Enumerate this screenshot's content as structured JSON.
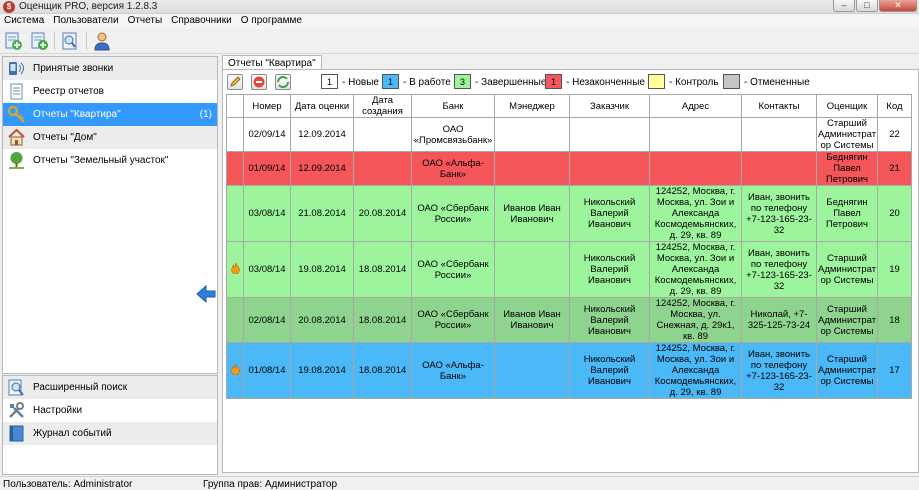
{
  "window": {
    "title": "Оценщик PRO, версия 1.2.8.3",
    "app_icon_letter": "$"
  },
  "menu": [
    "Система",
    "Пользователи",
    "Отчеты",
    "Справочники",
    "О программе"
  ],
  "toolbar_icons": [
    "new-report-icon",
    "add-report-icon",
    "preview-report-icon",
    "user-icon"
  ],
  "sidebar": {
    "items": [
      {
        "label": "Принятые звонки",
        "icon": "phone-calls-icon",
        "count": ""
      },
      {
        "label": "Реестр отчетов",
        "icon": "document-icon",
        "count": ""
      },
      {
        "label": "Отчеты \"Квартира\"",
        "icon": "key-icon",
        "count": "(1)"
      },
      {
        "label": "Отчеты \"Дом\"",
        "icon": "house-icon",
        "count": ""
      },
      {
        "label": "Отчеты \"Земельный участок\"",
        "icon": "tree-icon",
        "count": ""
      }
    ],
    "bottom_items": [
      {
        "label": "Расширенный поиск",
        "icon": "search-icon"
      },
      {
        "label": "Настройки",
        "icon": "tools-icon"
      },
      {
        "label": "Журнал событий",
        "icon": "log-icon"
      }
    ]
  },
  "tab": {
    "label": "Отчеты \"Квартира\""
  },
  "legend": [
    {
      "number": "1",
      "text": "- Новые",
      "color": "#ffffff"
    },
    {
      "number": "1",
      "text": "- В работе",
      "color": "#4bb8f7"
    },
    {
      "number": "3",
      "text": "- Завершенные",
      "color": "#9cf59c"
    },
    {
      "number": "1",
      "text": "- Незаконченные",
      "color": "#f4565a"
    },
    {
      "number": "",
      "text": "- Контроль",
      "color": "#ffff99"
    },
    {
      "number": "",
      "text": "- Отмененные",
      "color": "#c6c6c6"
    }
  ],
  "table": {
    "columns": [
      "",
      "Номер",
      "Дата оценки",
      "Дата создания",
      "Банк",
      "Мэнеджер",
      "Заказчик",
      "Адрес",
      "Контакты",
      "Оценщик",
      "Код"
    ],
    "rows": [
      {
        "style": "white",
        "flag": false,
        "cells": [
          "02/09/14",
          "12.09.2014",
          "",
          "ОАО «Промсвязьбанк»",
          "",
          "",
          "",
          "",
          "Старший Администрат ор Системы",
          "22"
        ]
      },
      {
        "style": "red",
        "flag": false,
        "cells": [
          "01/09/14",
          "12.09.2014",
          "",
          "ОАО «Альфа-Банк»",
          "",
          "",
          "",
          "",
          "Беднягин Павел Петрович",
          "21"
        ]
      },
      {
        "style": "green",
        "flag": false,
        "cells": [
          "03/08/14",
          "21.08.2014",
          "20.08.2014",
          "ОАО «Сбербанк России»",
          "Иванов Иван Иванович",
          "Никольский Валерий Иванович",
          "124252, Москва, г. Москва, ул. Зои и Александа Космодемьянских, д. 29, кв. 89",
          "Иван, звонить по телефону +7-123-165-23-32",
          "Беднягин Павел Петрович",
          "20"
        ]
      },
      {
        "style": "green",
        "flag": true,
        "cells": [
          "03/08/14",
          "19.08.2014",
          "18.08.2014",
          "ОАО «Сбербанк России»",
          "",
          "Никольский Валерий Иванович",
          "124252, Москва, г. Москва, ул. Зои и Александа Космодемьянских, д. 29, кв. 89",
          "Иван, звонить по телефону +7-123-165-23-32",
          "Старший Администрат ор Системы",
          "19"
        ]
      },
      {
        "style": "dgreen",
        "flag": false,
        "cells": [
          "02/08/14",
          "20.08.2014",
          "18.08.2014",
          "ОАО «Сбербанк России»",
          "Иванов Иван Иванович",
          "Никольский Валерий Иванович",
          "124252, Москва, г. Москва, ул. Снежная, д. 29к1, кв. 89",
          "Николай, +7-325-125-73-24",
          "Старший Администрат ор Системы",
          "18"
        ]
      },
      {
        "style": "blue",
        "flag": true,
        "cells": [
          "01/08/14",
          "19.08.2014",
          "18.08.2014",
          "ОАО «Альфа-Банк»",
          "",
          "Никольский Валерий Иванович",
          "124252, Москва, г. Москва, ул. Зои и Александа Космодемьянских, д. 29, кв. 89",
          "Иван, звонить по телефону +7-123-165-23-32",
          "Старший Администрат ор Системы",
          "17"
        ]
      }
    ]
  },
  "status": {
    "user": "Пользователь: Administrator",
    "group": "Группа прав: Администратор"
  }
}
